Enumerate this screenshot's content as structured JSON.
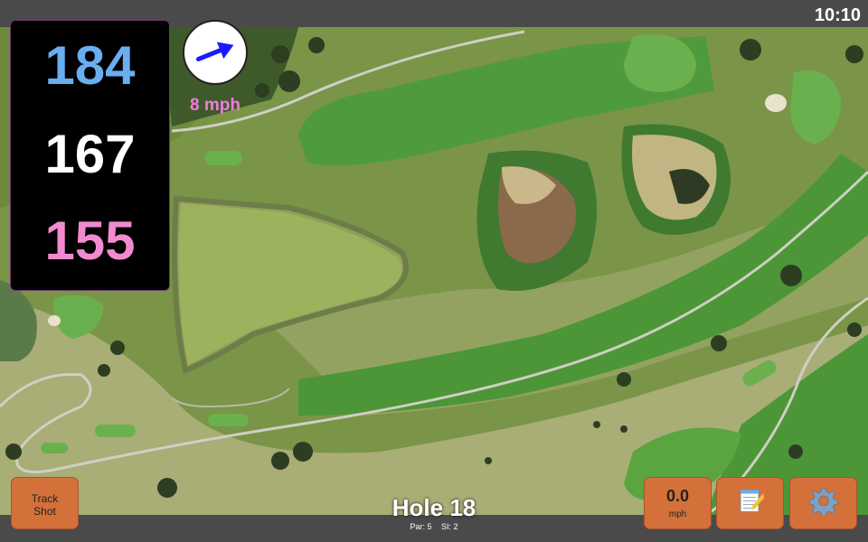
{
  "status_bar": {
    "time": "10:10"
  },
  "distances": {
    "back": {
      "value": "184",
      "color": "#6aaef0"
    },
    "middle": {
      "value": "167",
      "color": "#ffffff"
    },
    "front": {
      "value": "155",
      "color": "#f28ad0"
    }
  },
  "wind": {
    "speed_label": "8 mph",
    "speed_color": "#f07be0",
    "arrow_color": "#1a1aff",
    "icon": "wind-direction-arrow"
  },
  "buttons": {
    "track_shot": {
      "line1": "Track",
      "line2": "Shot"
    },
    "speed": {
      "value": "0.0",
      "unit": "mph"
    },
    "notes": {
      "icon": "notepad-icon"
    },
    "settings": {
      "icon": "gear-icon"
    }
  },
  "hole": {
    "title": "Hole 18",
    "par_label": "Par: 5",
    "si_label": "SI: 2"
  },
  "colors": {
    "button_bg": "#d4703a",
    "bar_bg": "#4a4a4a"
  }
}
